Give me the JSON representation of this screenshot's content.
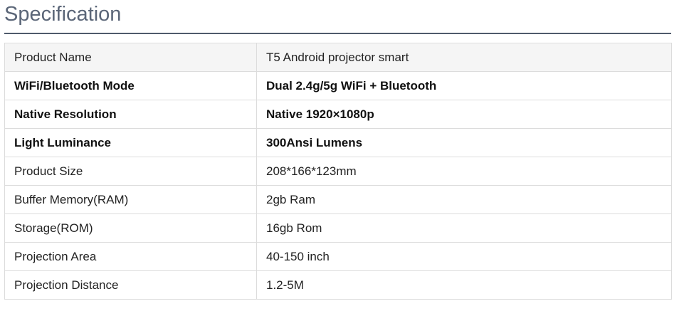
{
  "section": {
    "title": "Specification"
  },
  "rows": [
    {
      "label": "Product Name",
      "value": "T5 Android projector smart"
    },
    {
      "label": "WiFi/Bluetooth Mode",
      "value": "Dual 2.4g/5g WiFi + Bluetooth"
    },
    {
      "label": "Native Resolution",
      "value": "Native 1920×1080p"
    },
    {
      "label": "Light Luminance",
      "value": "300Ansi Lumens"
    },
    {
      "label": "Product Size",
      "value": "208*166*123mm"
    },
    {
      "label": "Buffer Memory(RAM)",
      "value": "2gb Ram"
    },
    {
      "label": "Storage(ROM)",
      "value": "16gb Rom"
    },
    {
      "label": "Projection Area",
      "value": "40-150 inch"
    },
    {
      "label": "Projection Distance",
      "value": "1.2-5M"
    }
  ]
}
